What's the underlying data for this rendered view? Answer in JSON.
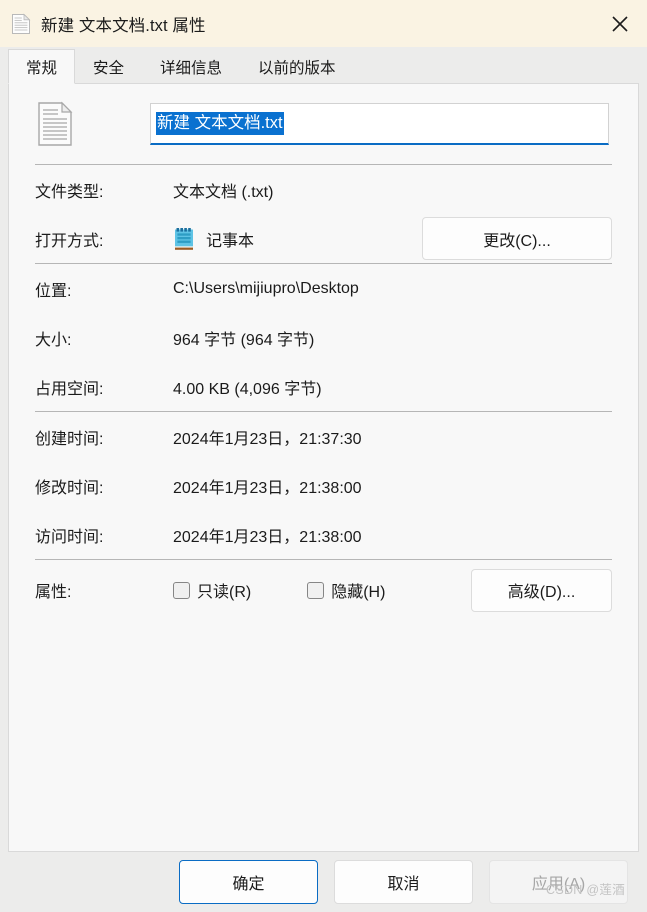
{
  "window": {
    "title": "新建 文本文档.txt 属性",
    "icon": "text-document-icon",
    "close_label": "✕",
    "titlebar_color": "#faf3e3"
  },
  "tabs": [
    {
      "label": "常规",
      "active": true
    },
    {
      "label": "安全",
      "active": false
    },
    {
      "label": "详细信息",
      "active": false
    },
    {
      "label": "以前的版本",
      "active": false
    }
  ],
  "general": {
    "file_icon": "text-file-icon",
    "filename_value": "新建 文本文档.txt",
    "filename_selected": true,
    "selection_color": "#0a71d0",
    "focus_color": "#0a6cc4",
    "rows": [
      {
        "label": "文件类型:",
        "value": "文本文档 (.txt)"
      },
      {
        "label": "打开方式:",
        "value": "记事本",
        "icon": "notepad-icon",
        "button": "更改(C)..."
      },
      {
        "label": "位置:",
        "value": "C:\\Users\\mijiupro\\Desktop"
      },
      {
        "label": "大小:",
        "value": "964 字节 (964 字节)"
      },
      {
        "label": "占用空间:",
        "value": "4.00 KB (4,096 字节)"
      },
      {
        "label": "创建时间:",
        "value": "2024年1月23日，21:37:30"
      },
      {
        "label": "修改时间:",
        "value": "2024年1月23日，21:38:00"
      },
      {
        "label": "访问时间:",
        "value": "2024年1月23日，21:38:00"
      }
    ],
    "attributes": {
      "label": "属性:",
      "readonly": {
        "label": "只读(R)",
        "checked": false
      },
      "hidden": {
        "label": "隐藏(H)",
        "checked": false
      },
      "advanced_button": "高级(D)..."
    }
  },
  "footer": {
    "ok": "确定",
    "cancel": "取消",
    "apply": "应用(A)",
    "apply_disabled": true
  },
  "watermark": "CSDN @莲酒"
}
